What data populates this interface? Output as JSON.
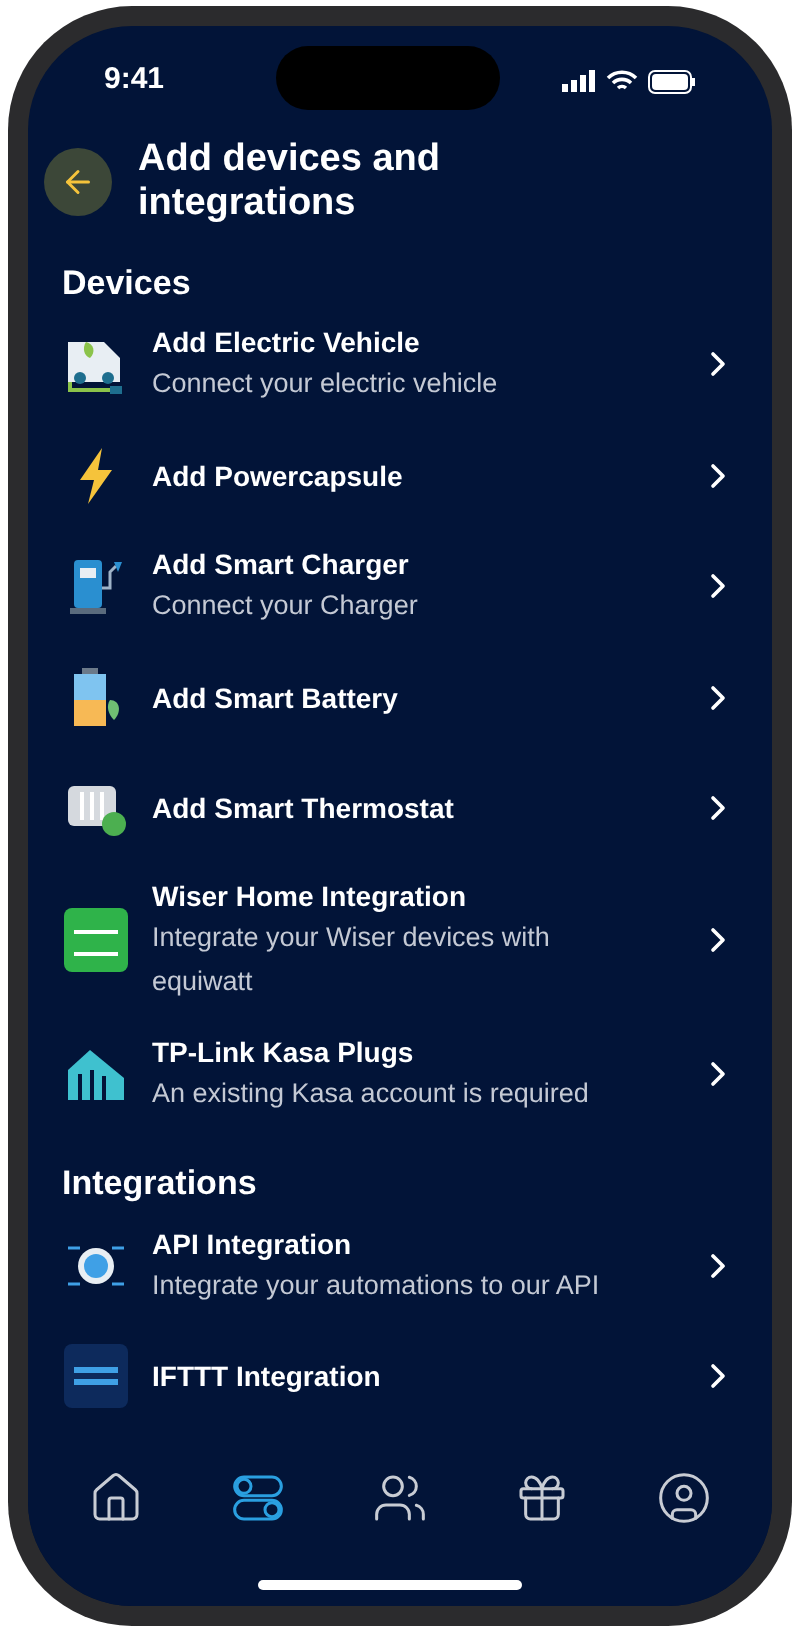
{
  "status_bar": {
    "time": "9:41"
  },
  "header": {
    "title": "Add devices and integrations"
  },
  "sections": [
    {
      "title": "Devices",
      "items": [
        {
          "kind": "ev",
          "title": "Add Electric Vehicle",
          "subtitle": "Connect your electric vehicle"
        },
        {
          "kind": "bolt",
          "title": "Add Powercapsule"
        },
        {
          "kind": "charger",
          "title": "Add Smart Charger",
          "subtitle": "Connect your Charger"
        },
        {
          "kind": "battery",
          "title": "Add Smart Battery"
        },
        {
          "kind": "thermostat",
          "title": "Add Smart Thermostat"
        },
        {
          "kind": "wiser",
          "title": "Wiser Home Integration",
          "subtitle": "Integrate your Wiser devices with equiwatt"
        },
        {
          "kind": "kasa",
          "title": "TP-Link Kasa Plugs",
          "subtitle": "An existing Kasa account is required"
        }
      ]
    },
    {
      "title": "Integrations",
      "items": [
        {
          "kind": "api",
          "title": "API Integration",
          "subtitle": "Integrate your automations to our API"
        },
        {
          "kind": "ifttt",
          "title": "IFTTT Integration"
        }
      ]
    }
  ],
  "nav": [
    {
      "kind": "home",
      "selected": false
    },
    {
      "kind": "toggles",
      "selected": true
    },
    {
      "kind": "people",
      "selected": false
    },
    {
      "kind": "gift",
      "selected": false
    },
    {
      "kind": "profile",
      "selected": false
    }
  ]
}
